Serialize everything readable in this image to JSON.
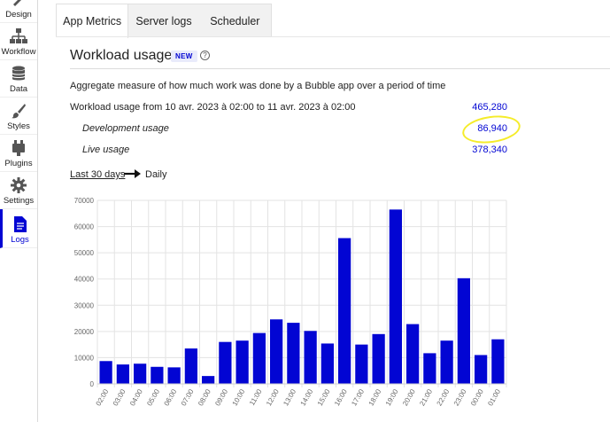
{
  "sidebar": {
    "items": [
      {
        "label": "Design",
        "icon": "design-icon"
      },
      {
        "label": "Workflow",
        "icon": "workflow-icon"
      },
      {
        "label": "Data",
        "icon": "database-icon"
      },
      {
        "label": "Styles",
        "icon": "brush-icon"
      },
      {
        "label": "Plugins",
        "icon": "plug-icon"
      },
      {
        "label": "Settings",
        "icon": "gear-icon"
      },
      {
        "label": "Logs",
        "icon": "document-icon"
      }
    ],
    "active": "Logs"
  },
  "tabs": [
    {
      "label": "App Metrics"
    },
    {
      "label": "Server logs"
    },
    {
      "label": "Scheduler"
    }
  ],
  "header": {
    "title": "Workload usage",
    "badge": "NEW",
    "help": "?"
  },
  "summary": {
    "description": "Aggregate measure of how much work was done by a Bubble app over a period of time",
    "period_label": "Workload usage from 10 avr. 2023 à 02:00 to 11 avr. 2023 à 02:00",
    "total": "465,280",
    "dev_label": "Development usage",
    "dev_value": "86,940",
    "live_label": "Live usage",
    "live_value": "378,340"
  },
  "controls": {
    "range": "Last 30 days",
    "granularity": "Daily"
  },
  "colors": {
    "accent": "#0205d3",
    "highlight": "#f5ec2a"
  },
  "chart_data": {
    "type": "bar",
    "categories": [
      "02:00",
      "03:00",
      "04:00",
      "05:00",
      "06:00",
      "07:00",
      "08:00",
      "09:00",
      "10:00",
      "11:00",
      "12:00",
      "13:00",
      "14:00",
      "15:00",
      "16:00",
      "17:00",
      "18:00",
      "19:00",
      "20:00",
      "21:00",
      "22:00",
      "23:00",
      "00:00",
      "01:00"
    ],
    "values": [
      8700,
      7400,
      7700,
      6500,
      6300,
      13500,
      3000,
      16000,
      16500,
      19400,
      24600,
      23300,
      20200,
      15400,
      55600,
      15000,
      19000,
      66500,
      22800,
      11700,
      16500,
      40300,
      11000,
      17000
    ],
    "yticks": [
      0,
      10000,
      20000,
      30000,
      40000,
      50000,
      60000,
      70000
    ],
    "ylim": [
      0,
      70000
    ],
    "grid": true,
    "color": "#0205d3"
  }
}
